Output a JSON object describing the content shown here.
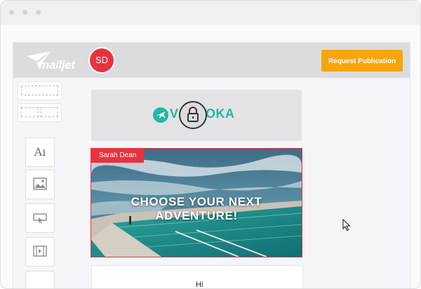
{
  "browser": {
    "dots": [
      "dot-1",
      "dot-2",
      "dot-3"
    ]
  },
  "header": {
    "logo_text": "mailjet",
    "avatar_initials": "SD",
    "request_publication_label": "Request Publication"
  },
  "sidebar": {
    "tools": [
      {
        "name": "text-tool",
        "glyph": "Aı",
        "icon": "text-icon"
      },
      {
        "name": "image-tool",
        "icon": "image-icon"
      },
      {
        "name": "button-tool",
        "icon": "button-icon"
      },
      {
        "name": "video-tool",
        "icon": "video-icon"
      }
    ]
  },
  "canvas": {
    "header_block": {
      "brand_text": "V       OKA",
      "locked_icon": "lock-icon"
    },
    "hero": {
      "name_tag": "Sarah Dean",
      "headline": "CHOOSE YOUR NEXT ADVENTURE!"
    },
    "text_block": {
      "content": "Hi"
    }
  },
  "colors": {
    "accent_orange": "#f6a50e",
    "avatar_red": "#e8323f",
    "brand_teal": "#23b7a2",
    "topbar_gray": "#dcdcde"
  }
}
